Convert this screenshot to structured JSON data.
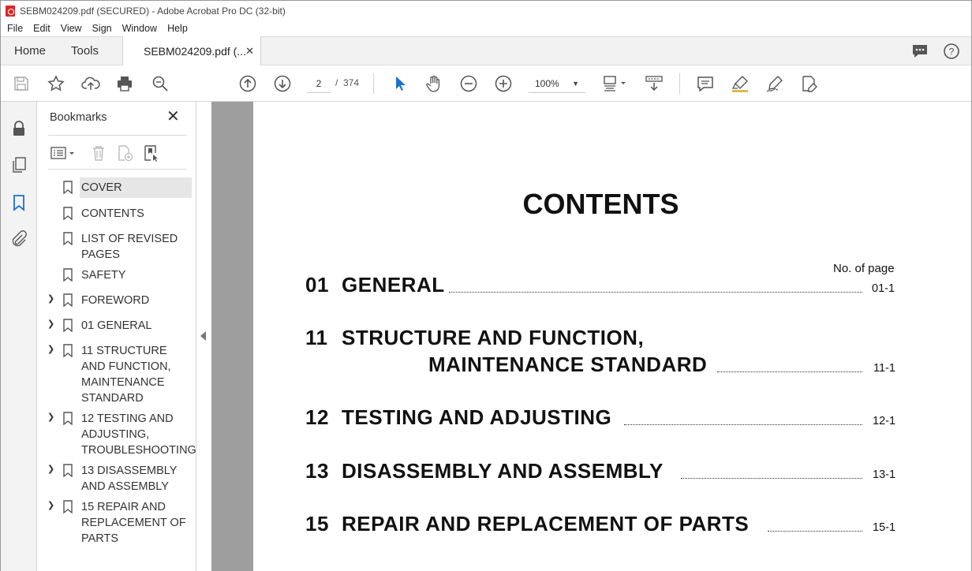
{
  "window": {
    "title": "SEBM024209.pdf (SECURED) - Adobe Acrobat Pro DC (32-bit)"
  },
  "menu": [
    "File",
    "Edit",
    "View",
    "Sign",
    "Window",
    "Help"
  ],
  "tabs": {
    "home": "Home",
    "tools": "Tools",
    "document": "SEBM024209.pdf (...",
    "close": "✕"
  },
  "toolbar": {
    "page_current": "2",
    "page_separator": "/",
    "page_total": "374",
    "zoom": "100%",
    "icons": [
      "save-icon",
      "bookmark-star-icon",
      "upload-icon",
      "print-icon",
      "zoom-search-icon",
      "prev-page-icon",
      "next-page-icon",
      "select-cursor-icon",
      "hand-icon",
      "zoom-out-icon",
      "zoom-in-icon",
      "page-fit-icon",
      "scroll-mode-icon",
      "comment-icon",
      "highlight-icon",
      "sign-icon",
      "edit-pdf-icon"
    ]
  },
  "rail": {
    "icons": [
      "lock-icon",
      "pages-icon",
      "bookmarks-icon",
      "attachment-icon"
    ]
  },
  "bookmarks": {
    "header": "Bookmarks",
    "close": "✕",
    "items": [
      {
        "label": "COVER",
        "expandable": false,
        "selected": true
      },
      {
        "label": "CONTENTS",
        "expandable": false
      },
      {
        "label": "LIST OF REVISED PAGES",
        "expandable": false
      },
      {
        "label": "SAFETY",
        "expandable": false
      },
      {
        "label": "FOREWORD",
        "expandable": true
      },
      {
        "label": "01 GENERAL",
        "expandable": true
      },
      {
        "label": "11 STRUCTURE AND FUNCTION, MAINTENANCE STANDARD",
        "expandable": true
      },
      {
        "label": "12 TESTING AND ADJUSTING, TROUBLESHOOTING",
        "expandable": true
      },
      {
        "label": "13 DISASSEMBLY AND ASSEMBLY",
        "expandable": true
      },
      {
        "label": "15 REPAIR AND REPLACEMENT OF PARTS",
        "expandable": true
      }
    ]
  },
  "document": {
    "title": "CONTENTS",
    "no_of_page": "No. of page",
    "toc": [
      {
        "num": "01",
        "title": "GENERAL",
        "page": "01-1"
      },
      {
        "num": "11",
        "title": "STRUCTURE AND FUNCTION,",
        "title_line2": "MAINTENANCE STANDARD",
        "page": "11-1"
      },
      {
        "num": "12",
        "title": "TESTING AND ADJUSTING",
        "page": "12-1"
      },
      {
        "num": "13",
        "title": "DISASSEMBLY AND ASSEMBLY",
        "page": "13-1"
      },
      {
        "num": "15",
        "title": "REPAIR AND REPLACEMENT OF PARTS",
        "page": "15-1"
      }
    ]
  }
}
